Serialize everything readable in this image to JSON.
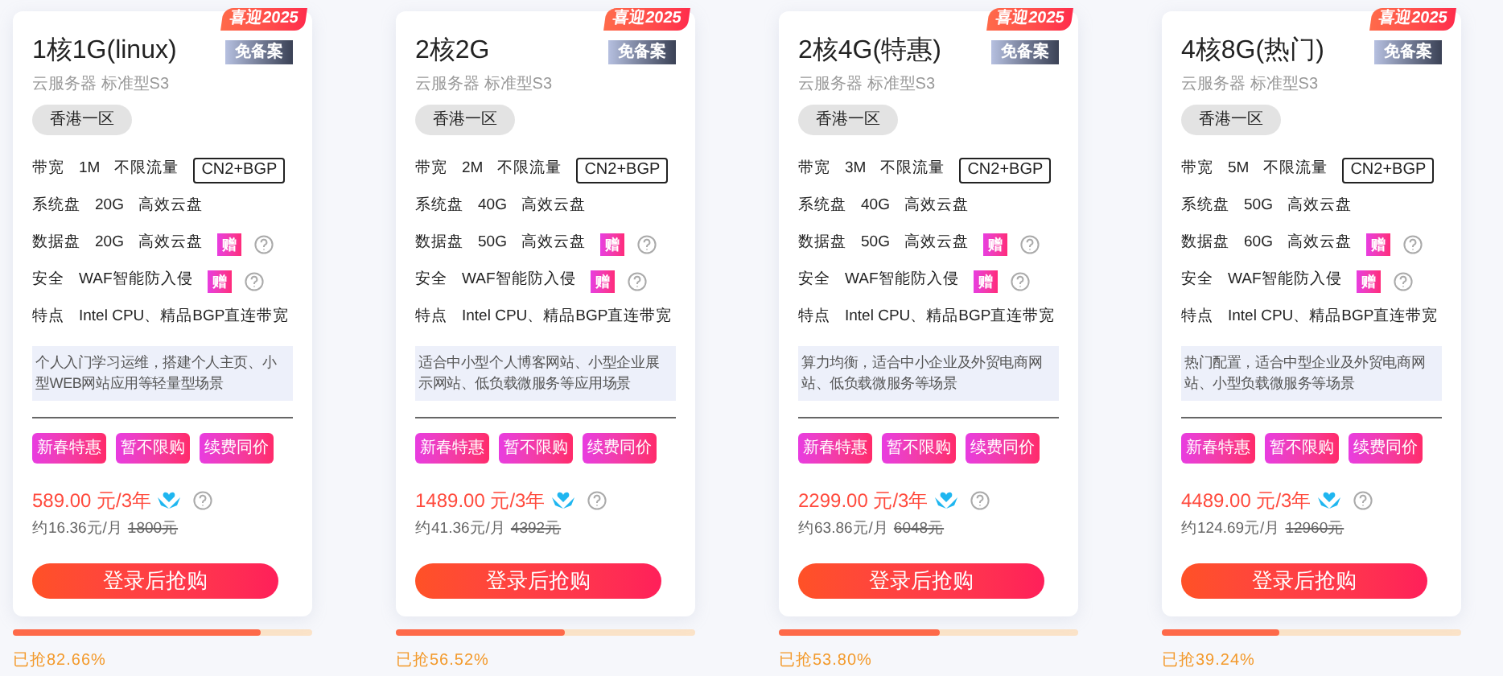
{
  "plans": [
    {
      "ribbon": "喜迎2025",
      "title": "1核1G(linux)",
      "badge": "免备案",
      "subtitle": "云服务器 标准型S3",
      "region": "香港一区",
      "specs": [
        {
          "label": "带宽",
          "values": [
            "1M",
            "不限流量"
          ],
          "tag": "CN2+BGP",
          "help": false
        },
        {
          "label": "系统盘",
          "values": [
            "20G",
            "高效云盘"
          ],
          "help": false
        },
        {
          "label": "数据盘",
          "values": [
            "20G",
            "高效云盘"
          ],
          "gift": "赠",
          "help": true
        },
        {
          "label": "安全",
          "values": [
            "WAF智能防入侵"
          ],
          "gift": "赠",
          "help": true
        },
        {
          "label": "特点",
          "values": [
            "Intel CPU、精品BGP直连带宽"
          ],
          "help": false
        }
      ],
      "description": "个人入门学习运维，搭建个人主页、小型WEB网站应用等轻量型场景",
      "promos": [
        "新春特惠",
        "暂不限购",
        "续费同价"
      ],
      "price": "589.00 元/3年",
      "monthly": "约16.36元/月",
      "original_price": "1800元",
      "button": "登录后抢购",
      "level": 0.8266,
      "sold": "已抢82.66%"
    },
    {
      "ribbon": "喜迎2025",
      "title": "2核2G",
      "badge": "免备案",
      "subtitle": "云服务器 标准型S3",
      "region": "香港一区",
      "specs": [
        {
          "label": "带宽",
          "values": [
            "2M",
            "不限流量"
          ],
          "tag": "CN2+BGP",
          "help": false
        },
        {
          "label": "系统盘",
          "values": [
            "40G",
            "高效云盘"
          ],
          "help": false
        },
        {
          "label": "数据盘",
          "values": [
            "50G",
            "高效云盘"
          ],
          "gift": "赠",
          "help": true
        },
        {
          "label": "安全",
          "values": [
            "WAF智能防入侵"
          ],
          "gift": "赠",
          "help": true
        },
        {
          "label": "特点",
          "values": [
            "Intel CPU、精品BGP直连带宽"
          ],
          "help": false
        }
      ],
      "description": "适合中小型个人博客网站、小型企业展示网站、低负载微服务等应用场景",
      "promos": [
        "新春特惠",
        "暂不限购",
        "续费同价"
      ],
      "price": "1489.00 元/3年",
      "monthly": "约41.36元/月",
      "original_price": "4392元",
      "button": "登录后抢购",
      "level": 0.5652,
      "sold": "已抢56.52%"
    },
    {
      "ribbon": "喜迎2025",
      "title": "2核4G(特惠)",
      "badge": "免备案",
      "subtitle": "云服务器 标准型S3",
      "region": "香港一区",
      "specs": [
        {
          "label": "带宽",
          "values": [
            "3M",
            "不限流量"
          ],
          "tag": "CN2+BGP",
          "help": false
        },
        {
          "label": "系统盘",
          "values": [
            "40G",
            "高效云盘"
          ],
          "help": false
        },
        {
          "label": "数据盘",
          "values": [
            "50G",
            "高效云盘"
          ],
          "gift": "赠",
          "help": true
        },
        {
          "label": "安全",
          "values": [
            "WAF智能防入侵"
          ],
          "gift": "赠",
          "help": true
        },
        {
          "label": "特点",
          "values": [
            "Intel CPU、精品BGP直连带宽"
          ],
          "help": false
        }
      ],
      "description": "算力均衡，适合中小企业及外贸电商网站、低负载微服务等场景",
      "promos": [
        "新春特惠",
        "暂不限购",
        "续费同价"
      ],
      "price": "2299.00 元/3年",
      "monthly": "约63.86元/月",
      "original_price": "6048元",
      "button": "登录后抢购",
      "level": 0.538,
      "sold": "已抢53.80%"
    },
    {
      "ribbon": "喜迎2025",
      "title": "4核8G(热门)",
      "badge": "免备案",
      "subtitle": "云服务器 标准型S3",
      "region": "香港一区",
      "specs": [
        {
          "label": "带宽",
          "values": [
            "5M",
            "不限流量"
          ],
          "tag": "CN2+BGP",
          "help": false
        },
        {
          "label": "系统盘",
          "values": [
            "50G",
            "高效云盘"
          ],
          "help": false
        },
        {
          "label": "数据盘",
          "values": [
            "60G",
            "高效云盘"
          ],
          "gift": "赠",
          "help": true
        },
        {
          "label": "安全",
          "values": [
            "WAF智能防入侵"
          ],
          "gift": "赠",
          "help": true
        },
        {
          "label": "特点",
          "values": [
            "Intel CPU、精品BGP直连带宽"
          ],
          "help": false
        }
      ],
      "description": "热门配置，适合中型企业及外贸电商网站、小型负载微服务等场景",
      "promos": [
        "新春特惠",
        "暂不限购",
        "续费同价"
      ],
      "price": "4489.00 元/3年",
      "monthly": "约124.69元/月",
      "original_price": "12960元",
      "button": "登录后抢购",
      "level": 0.3924,
      "sold": "已抢39.24%"
    }
  ]
}
